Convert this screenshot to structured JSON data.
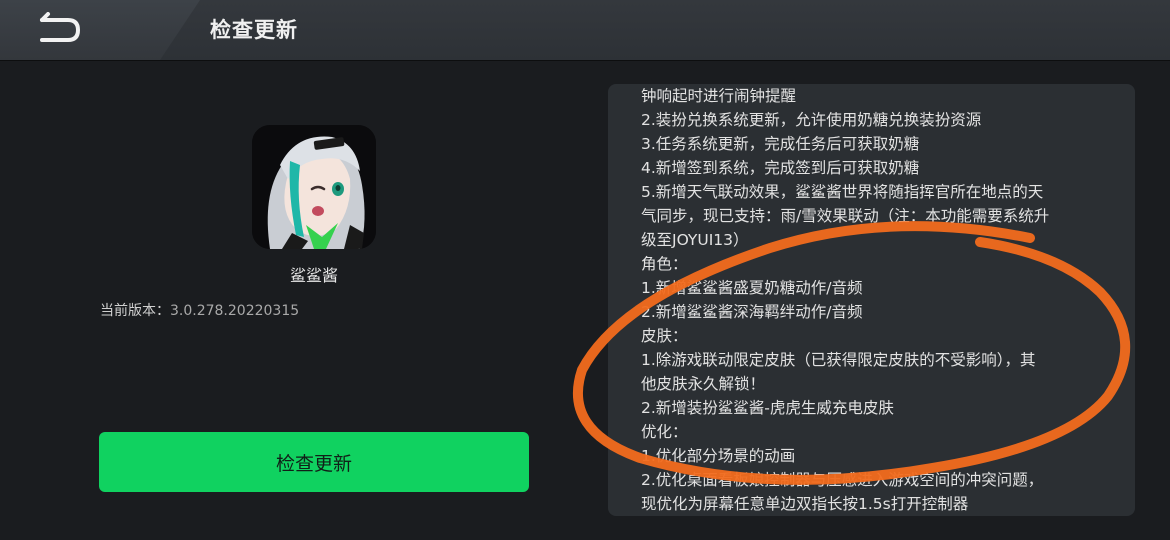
{
  "header": {
    "title": "检查更新"
  },
  "app": {
    "name": "鲨鲨酱",
    "version_label": "当前版本：",
    "version_value": "3.0.278.20220315"
  },
  "actions": {
    "check_update_label": "检查更新"
  },
  "changelog": {
    "lines": [
      "钟响起时进行闹钟提醒",
      "2.装扮兑换系统更新，允许使用奶糖兑换装扮资源",
      "3.任务系统更新，完成任务后可获取奶糖",
      "4.新增签到系统，完成签到后可获取奶糖",
      "5.新增天气联动效果，鲨鲨酱世界将随指挥官所在地点的天",
      "气同步，现已支持：雨/雪效果联动（注：本功能需要系统升",
      "级至JOYUI13）",
      "角色：",
      "1.新增鲨鲨酱盛夏奶糖动作/音频",
      "2.新增鲨鲨酱深海羁绊动作/音频",
      "皮肤：",
      "1.除游戏联动限定皮肤（已获得限定皮肤的不受影响），其",
      "他皮肤永久解锁！",
      "2.新增装扮鲨鲨酱-虎虎生威充电皮肤",
      "优化：",
      "1.优化部分场景的动画",
      "2.优化桌面看板娘控制器与压感进入游戏空间的冲突问题，",
      "现优化为屏幕任意单边双指长按1.5s打开控制器"
    ]
  },
  "colors": {
    "header_bg": "#2d3136",
    "page_bg": "#1a1c1f",
    "panel_bg": "#2b2f33",
    "primary_button": "#10d260",
    "annotation_stroke": "#f26b1d"
  },
  "icons": {
    "back": "back-arrow-icon",
    "app": "app-avatar-icon"
  }
}
